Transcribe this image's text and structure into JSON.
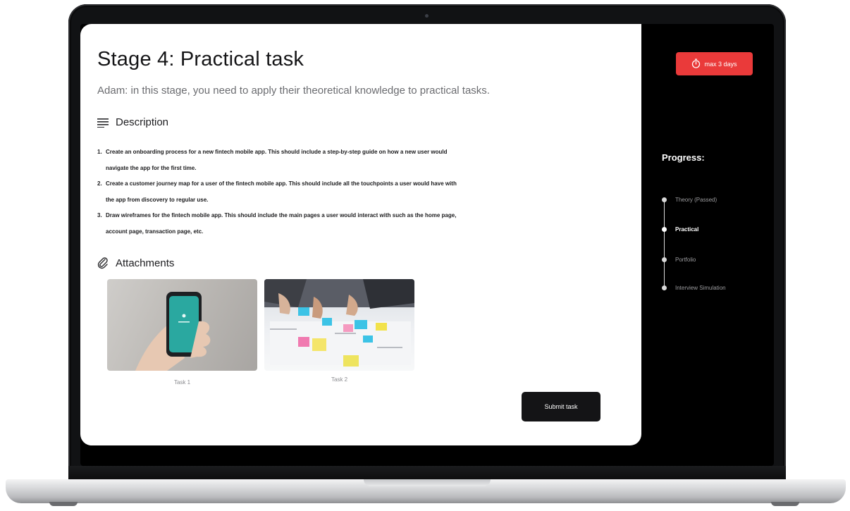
{
  "stage": {
    "title": "Stage 4: Practical task",
    "subtitle": "Adam: in this stage, you need to apply their theoretical knowledge to practical tasks."
  },
  "description": {
    "heading": "Description",
    "items": [
      {
        "num": "1.",
        "text": "Create an onboarding process for a new fintech mobile app. This should include a step-by-step guide on how a new user would",
        "cont": "navigate the app for the first time."
      },
      {
        "num": "2.",
        "text": "Create a customer journey map for a user of the fintech mobile app. This should include all the touchpoints a user would have with",
        "cont": "the app from discovery to regular use."
      },
      {
        "num": "3.",
        "text": "Draw wireframes for the fintech mobile app. This should include the main pages a user would interact with such as the home page,",
        "cont": "account page, transaction page, etc."
      }
    ]
  },
  "attachments": {
    "heading": "Attachments",
    "files": [
      {
        "label": "Task 1"
      },
      {
        "label": "Task 2"
      }
    ]
  },
  "actions": {
    "submit_label": "Submit task"
  },
  "sidebar": {
    "timer_label": "max 3 days",
    "progress_title": "Progress:",
    "steps": [
      {
        "label": "Theory (Passed)"
      },
      {
        "label": "Practical"
      },
      {
        "label": "Portfolio"
      },
      {
        "label": "Interview Simulation"
      }
    ]
  },
  "colors": {
    "accent_red": "#ea3a3a",
    "button_dark": "#141416"
  }
}
